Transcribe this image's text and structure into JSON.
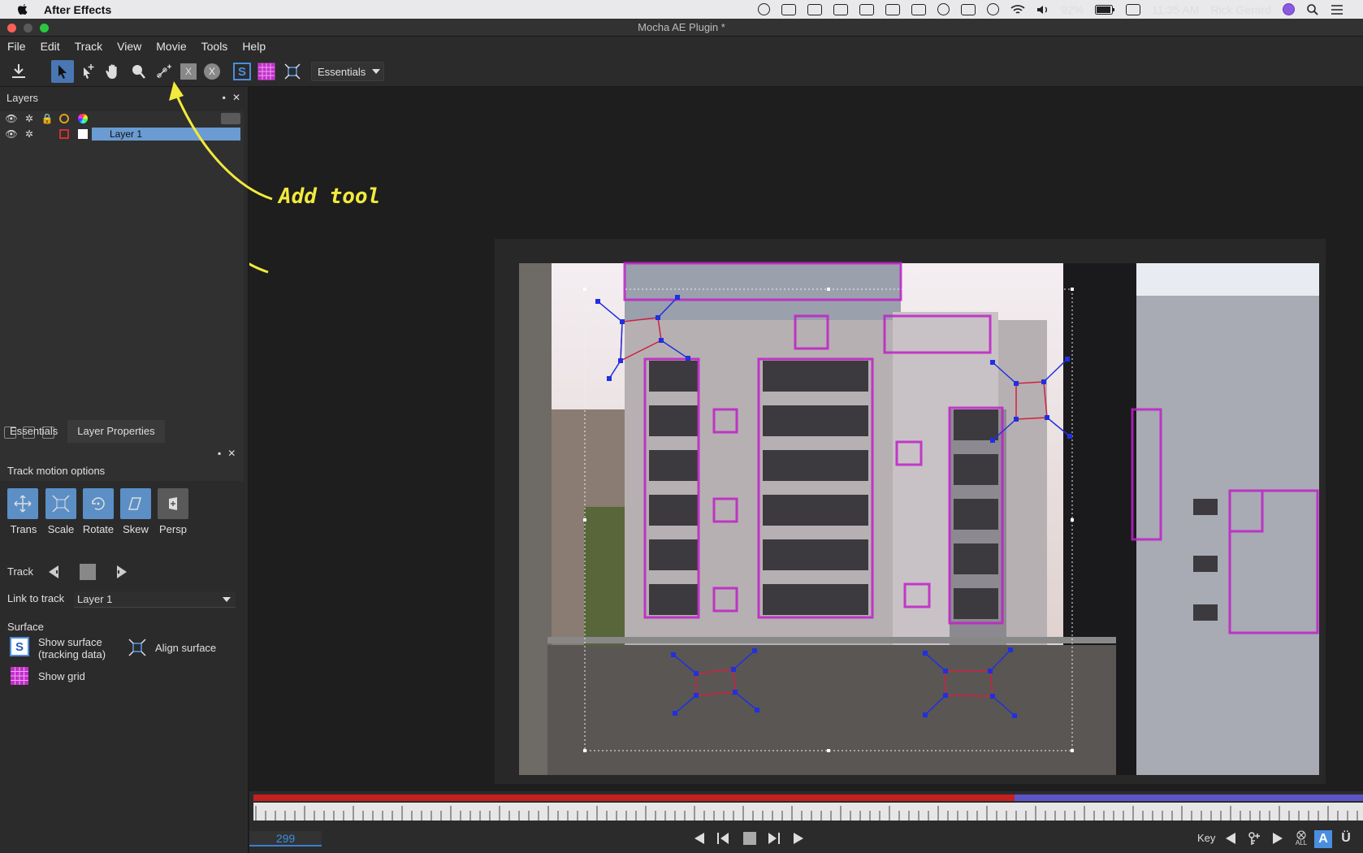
{
  "system_menubar": {
    "app_name": "After Effects",
    "battery": "92%",
    "time": "11:35 AM",
    "user": "Rick Gerard"
  },
  "window": {
    "title": "Mocha AE Plugin *"
  },
  "menu": [
    "File",
    "Edit",
    "Track",
    "View",
    "Movie",
    "Tools",
    "Help"
  ],
  "toolbar": {
    "workspace": "Essentials",
    "tools": [
      "export-icon",
      "select-icon",
      "select-add-icon",
      "hand-icon",
      "zoom-icon",
      "add-point-icon",
      "x-spline-icon",
      "bezier-icon",
      "surface-icon",
      "grid-icon",
      "align-icon"
    ]
  },
  "layers_panel": {
    "title": "Layers",
    "layers": [
      {
        "name": "Layer 1",
        "selected": true,
        "color": "#d03030"
      }
    ]
  },
  "props_tabs": [
    "Essentials",
    "Layer Properties"
  ],
  "essentials": {
    "track_motion_title": "Track motion options",
    "motion_options": [
      {
        "label": "Trans",
        "enabled": true
      },
      {
        "label": "Scale",
        "enabled": true
      },
      {
        "label": "Rotate",
        "enabled": true
      },
      {
        "label": "Skew",
        "enabled": true
      },
      {
        "label": "Persp",
        "enabled": false
      }
    ],
    "track_label": "Track",
    "link_to_track_label": "Link to track",
    "link_to_track_value": "Layer 1",
    "surface_title": "Surface",
    "show_surface_line1": "Show surface",
    "show_surface_line2": "(tracking data)",
    "align_surface": "Align surface",
    "show_grid": "Show grid"
  },
  "annotation": {
    "text": "Add tool"
  },
  "timeline": {
    "current_frame": "299",
    "key_label": "Key",
    "all_label": "ALL"
  },
  "colors": {
    "accent_blue": "#4a76b4",
    "tracked_range": "#c42020",
    "untracked_range": "#5b55c8",
    "annotation": "#f2ea3c",
    "spline": "#c020c8"
  }
}
